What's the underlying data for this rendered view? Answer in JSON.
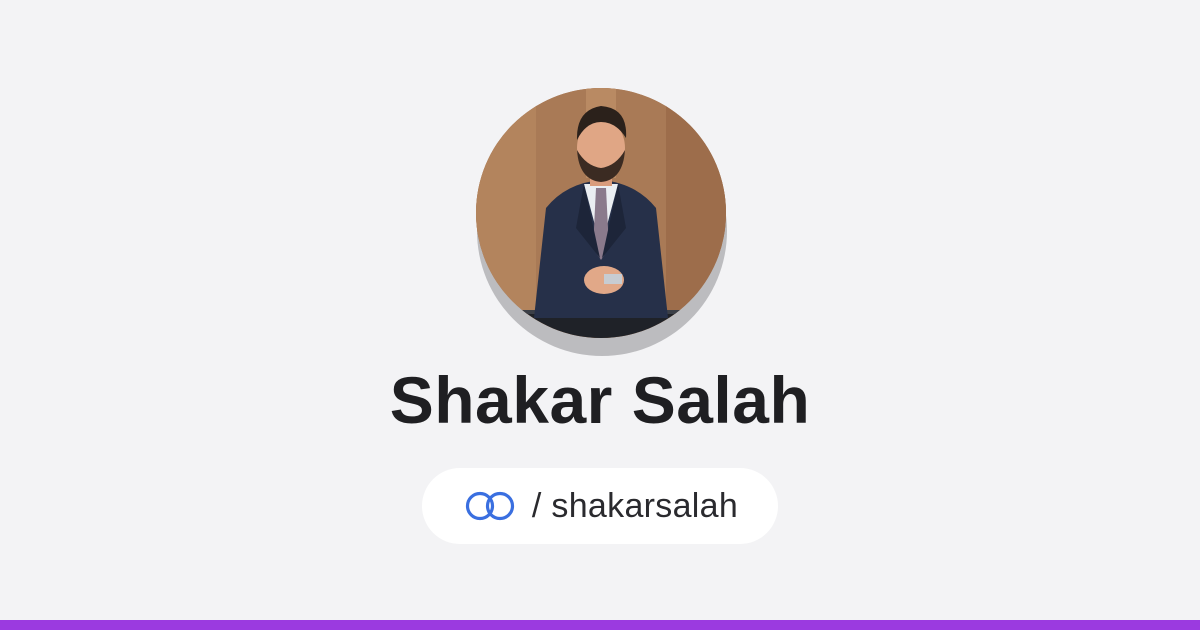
{
  "profile": {
    "name": "Shakar Salah",
    "handle_prefix": "/ ",
    "handle": "shakarsalah"
  },
  "icons": {
    "avatar": "profile-photo",
    "link": "linked-rings-icon"
  },
  "colors": {
    "background": "#f3f3f5",
    "accent_bar": "#9b3ae0",
    "link_icon": "#3a6fe0",
    "name_text": "#1f1f22",
    "pill_background": "#ffffff"
  }
}
